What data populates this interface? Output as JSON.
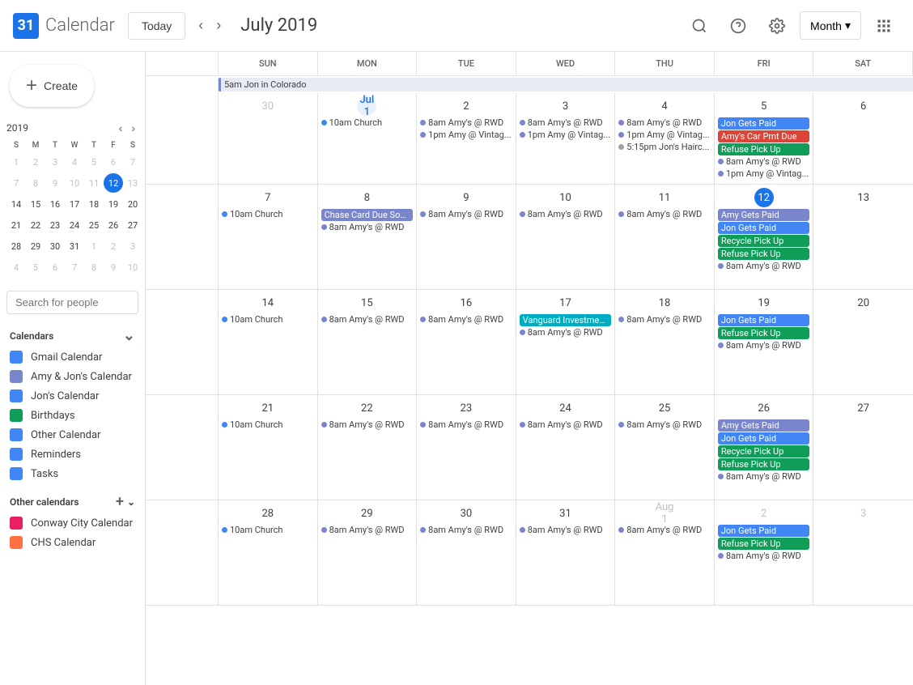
{
  "header": {
    "logo_num": "31",
    "logo_text": "Calendar",
    "today_btn": "Today",
    "title": "July 2019",
    "month_btn": "Month",
    "search_icon": "🔍",
    "help_icon": "?",
    "settings_icon": "⚙",
    "grid_icon": "⋮⋮⋮"
  },
  "mini_cal": {
    "year": "2019",
    "days_header": [
      "S",
      "M",
      "T",
      "W",
      "T",
      "F",
      "S"
    ],
    "weeks": [
      [
        {
          "d": "1",
          "m": "other"
        },
        {
          "d": "2",
          "m": "other"
        },
        {
          "d": "3",
          "m": "other"
        },
        {
          "d": "4",
          "m": "other"
        },
        {
          "d": "5",
          "m": "other"
        },
        {
          "d": "6",
          "m": "other"
        },
        {
          "d": "7",
          "m": "other"
        }
      ],
      [
        {
          "d": "7",
          "m": "other"
        },
        {
          "d": "8",
          "m": "other"
        },
        {
          "d": "9",
          "m": "other"
        },
        {
          "d": "10",
          "m": "other"
        },
        {
          "d": "11",
          "m": "other"
        },
        {
          "d": "12",
          "m": "today"
        },
        {
          "d": "13",
          "m": "other"
        }
      ],
      [
        {
          "d": "14"
        },
        {
          "d": "15"
        },
        {
          "d": "16"
        },
        {
          "d": "17"
        },
        {
          "d": "18"
        },
        {
          "d": "19"
        },
        {
          "d": "20"
        }
      ],
      [
        {
          "d": "21"
        },
        {
          "d": "22"
        },
        {
          "d": "23"
        },
        {
          "d": "24"
        },
        {
          "d": "25"
        },
        {
          "d": "26"
        },
        {
          "d": "27"
        }
      ],
      [
        {
          "d": "28"
        },
        {
          "d": "29"
        },
        {
          "d": "30"
        },
        {
          "d": "31",
          "m": ""
        },
        {
          "d": "1",
          "m": "other"
        },
        {
          "d": "2",
          "m": "other"
        },
        {
          "d": "3",
          "m": "other"
        }
      ],
      [
        {
          "d": "4",
          "m": "other"
        },
        {
          "d": "5",
          "m": "other"
        },
        {
          "d": "6",
          "m": "other"
        },
        {
          "d": "7",
          "m": "other"
        },
        {
          "d": "8",
          "m": "other"
        },
        {
          "d": "9",
          "m": "other"
        },
        {
          "d": "10",
          "m": "other"
        }
      ]
    ]
  },
  "sidebar": {
    "create_btn": "+ Create",
    "search_placeholder": "Search for people",
    "calendars_label": "Calendars",
    "calendars": [
      {
        "name": "Gmail Calendar",
        "color": "#4285f4"
      },
      {
        "name": "Amy & Jon's Calendar",
        "color": "#7986cb"
      },
      {
        "name": "Birthdays",
        "color": "#0f9d58"
      },
      {
        "name": "Other Calendar",
        "color": "#4285f4"
      },
      {
        "name": "Reminders",
        "color": "#4285f4"
      },
      {
        "name": "Tasks",
        "color": "#4285f4"
      }
    ],
    "other_calendars_label": "Other calendars",
    "other_calendars": [
      {
        "name": "Conway City Calendar",
        "color": "#e91e63"
      },
      {
        "name": "CHS Calendar",
        "color": "#ff7043"
      }
    ],
    "jons_cal_label": "Jon's Calendar"
  },
  "cal": {
    "day_headers": [
      "SUN",
      "MON",
      "TUE",
      "WED",
      "THU",
      "FRI",
      "SAT"
    ],
    "day_nums_row1": [
      "30",
      "Jul 1",
      "2",
      "3",
      "4",
      "5",
      "6"
    ],
    "day_nums_row2": [
      "7",
      "8",
      "9",
      "10",
      "11",
      "12",
      "13"
    ],
    "day_nums_row3": [
      "14",
      "15",
      "16",
      "17",
      "18",
      "19",
      "20"
    ],
    "day_nums_row4": [
      "21",
      "22",
      "23",
      "24",
      "25",
      "26",
      "27"
    ],
    "day_nums_row5": [
      "28",
      "29",
      "30",
      "31",
      "Aug 1",
      "2",
      "3"
    ],
    "weeks": {
      "w1": {
        "span_event": "5am Jon in Colorado",
        "sun": [],
        "mon": [
          {
            "type": "dot",
            "dot": "blue",
            "text": "10am Church"
          }
        ],
        "tue": [
          {
            "type": "dot",
            "dot": "purple",
            "text": "8am Amy's @ RWD"
          },
          {
            "type": "dot",
            "dot": "purple",
            "text": "1pm Amy @ Vintag..."
          }
        ],
        "wed": [
          {
            "type": "dot",
            "dot": "purple",
            "text": "8am Amy's @ RWD"
          },
          {
            "type": "dot",
            "dot": "purple",
            "text": "1pm Amy @ Vintag..."
          }
        ],
        "thu": [
          {
            "type": "dot",
            "dot": "purple",
            "text": "8am Amy's @ RWD"
          },
          {
            "type": "dot",
            "dot": "purple",
            "text": "1pm Amy @ Vintag..."
          },
          {
            "type": "dot",
            "dot": "gray",
            "text": "5:15pm Jon's Hairc..."
          }
        ],
        "fri": [
          {
            "type": "block",
            "color": "ev-blue",
            "text": "Jon Gets Paid"
          },
          {
            "type": "block",
            "color": "ev-red",
            "text": "Amy's Car Pmt Due"
          },
          {
            "type": "block",
            "color": "ev-green",
            "text": "Refuse Pick Up"
          },
          {
            "type": "dot",
            "dot": "purple",
            "text": "8am Amy's @ RWD"
          },
          {
            "type": "dot",
            "dot": "purple",
            "text": "1pm Amy @ Vintag..."
          }
        ],
        "sat": []
      },
      "w2": {
        "sun": [
          {
            "type": "dot",
            "dot": "blue",
            "text": "10am Church"
          }
        ],
        "mon": [
          {
            "type": "block-span",
            "color": "ev-purple",
            "text": "Chase Card Due Soo..."
          },
          {
            "type": "dot",
            "dot": "purple",
            "text": "8am Amy's @ RWD"
          }
        ],
        "tue": [
          {
            "type": "dot",
            "dot": "purple",
            "text": "8am Amy's @ RWD"
          }
        ],
        "wed": [
          {
            "type": "dot",
            "dot": "purple",
            "text": "8am Amy's @ RWD"
          }
        ],
        "thu": [
          {
            "type": "dot",
            "dot": "purple",
            "text": "8am Amy's @ RWD"
          }
        ],
        "fri": [
          {
            "type": "block",
            "color": "ev-purple",
            "text": "Amy Gets Paid"
          },
          {
            "type": "block",
            "color": "ev-blue",
            "text": "Jon Gets Paid"
          },
          {
            "type": "block",
            "color": "ev-green",
            "text": "Recycle Pick Up"
          },
          {
            "type": "block",
            "color": "ev-green",
            "text": "Refuse Pick Up"
          },
          {
            "type": "dot",
            "dot": "purple",
            "text": "8am Amy's @ RWD"
          }
        ],
        "sat": []
      },
      "w3": {
        "sun": [
          {
            "type": "dot",
            "dot": "blue",
            "text": "10am Church"
          }
        ],
        "mon": [
          {
            "type": "dot",
            "dot": "purple",
            "text": "8am Amy's @ RWD"
          }
        ],
        "tue": [
          {
            "type": "dot",
            "dot": "purple",
            "text": "8am Amy's @ RWD"
          }
        ],
        "wed": [
          {
            "type": "block",
            "color": "ev-teal",
            "text": "Vanguard Investmen..."
          },
          {
            "type": "dot",
            "dot": "purple",
            "text": "8am Amy's @ RWD"
          }
        ],
        "thu": [
          {
            "type": "dot",
            "dot": "purple",
            "text": "8am Amy's @ RWD"
          }
        ],
        "fri": [
          {
            "type": "block",
            "color": "ev-blue",
            "text": "Jon Gets Paid"
          },
          {
            "type": "block",
            "color": "ev-green",
            "text": "Refuse Pick Up"
          },
          {
            "type": "dot",
            "dot": "purple",
            "text": "8am Amy's @ RWD"
          }
        ],
        "sat": []
      },
      "w4": {
        "sun": [
          {
            "type": "dot",
            "dot": "blue",
            "text": "10am Church"
          }
        ],
        "mon": [
          {
            "type": "dot",
            "dot": "purple",
            "text": "8am Amy's @ RWD"
          }
        ],
        "tue": [
          {
            "type": "dot",
            "dot": "purple",
            "text": "8am Amy's @ RWD"
          }
        ],
        "wed": [
          {
            "type": "dot",
            "dot": "purple",
            "text": "8am Amy's @ RWD"
          }
        ],
        "thu": [
          {
            "type": "dot",
            "dot": "purple",
            "text": "8am Amy's @ RWD"
          }
        ],
        "fri": [
          {
            "type": "block",
            "color": "ev-purple",
            "text": "Amy Gets Paid"
          },
          {
            "type": "block",
            "color": "ev-blue",
            "text": "Jon Gets Paid"
          },
          {
            "type": "block",
            "color": "ev-green",
            "text": "Recycle Pick Up"
          },
          {
            "type": "block",
            "color": "ev-green",
            "text": "Refuse Pick Up"
          },
          {
            "type": "dot",
            "dot": "purple",
            "text": "8am Amy's @ RWD"
          }
        ],
        "sat": []
      },
      "w5": {
        "sun": [
          {
            "type": "dot",
            "dot": "blue",
            "text": "10am Church"
          }
        ],
        "mon": [
          {
            "type": "dot",
            "dot": "purple",
            "text": "8am Amy's @ RWD"
          }
        ],
        "tue": [
          {
            "type": "dot",
            "dot": "purple",
            "text": "8am Amy's @ RWD"
          }
        ],
        "wed": [
          {
            "type": "dot",
            "dot": "purple",
            "text": "8am Amy's @ RWD"
          }
        ],
        "thu": [
          {
            "type": "dot",
            "dot": "purple",
            "text": "8am Amy's @ RWD"
          }
        ],
        "fri": [
          {
            "type": "block",
            "color": "ev-blue",
            "text": "Jon Gets Paid"
          },
          {
            "type": "block",
            "color": "ev-green",
            "text": "Refuse Pick Up"
          },
          {
            "type": "dot",
            "dot": "purple",
            "text": "8am Amy's @ RWD"
          }
        ],
        "sat": []
      }
    }
  }
}
